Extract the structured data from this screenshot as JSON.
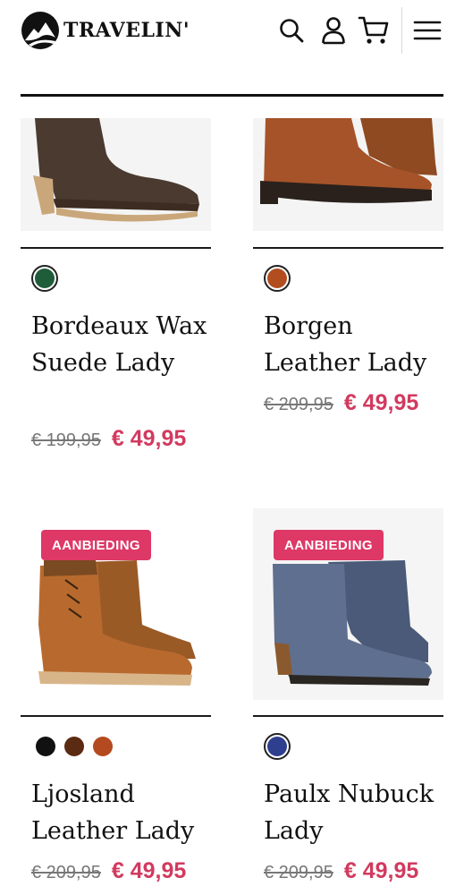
{
  "header": {
    "brand": "TRAVELIN'",
    "icons": [
      "search-icon",
      "account-icon",
      "cart-icon",
      "menu-icon"
    ]
  },
  "colors": {
    "accent": "#d23a5f",
    "badge": "#de3866"
  },
  "products": [
    {
      "name": "Bordeaux Wax Suede Lady",
      "old_price": "€ 199,95",
      "new_price": "€ 49,95",
      "badge": "",
      "swatches": [
        "#1f5c3a"
      ]
    },
    {
      "name": "Borgen Leather Lady",
      "old_price": "€ 209,95",
      "new_price": "€ 49,95",
      "badge": "",
      "swatches": [
        "#b24d1f"
      ]
    },
    {
      "name": "Ljosland Leather Lady",
      "old_price": "€ 209,95",
      "new_price": "€ 49,95",
      "badge": "AANBIEDING",
      "swatches": [
        "#111111",
        "#5a2a12",
        "#b44a1f"
      ]
    },
    {
      "name": "Paulx Nubuck Lady",
      "old_price": "€ 209,95",
      "new_price": "€ 49,95",
      "badge": "AANBIEDING",
      "swatches": [
        "#2e3f8f"
      ]
    }
  ]
}
